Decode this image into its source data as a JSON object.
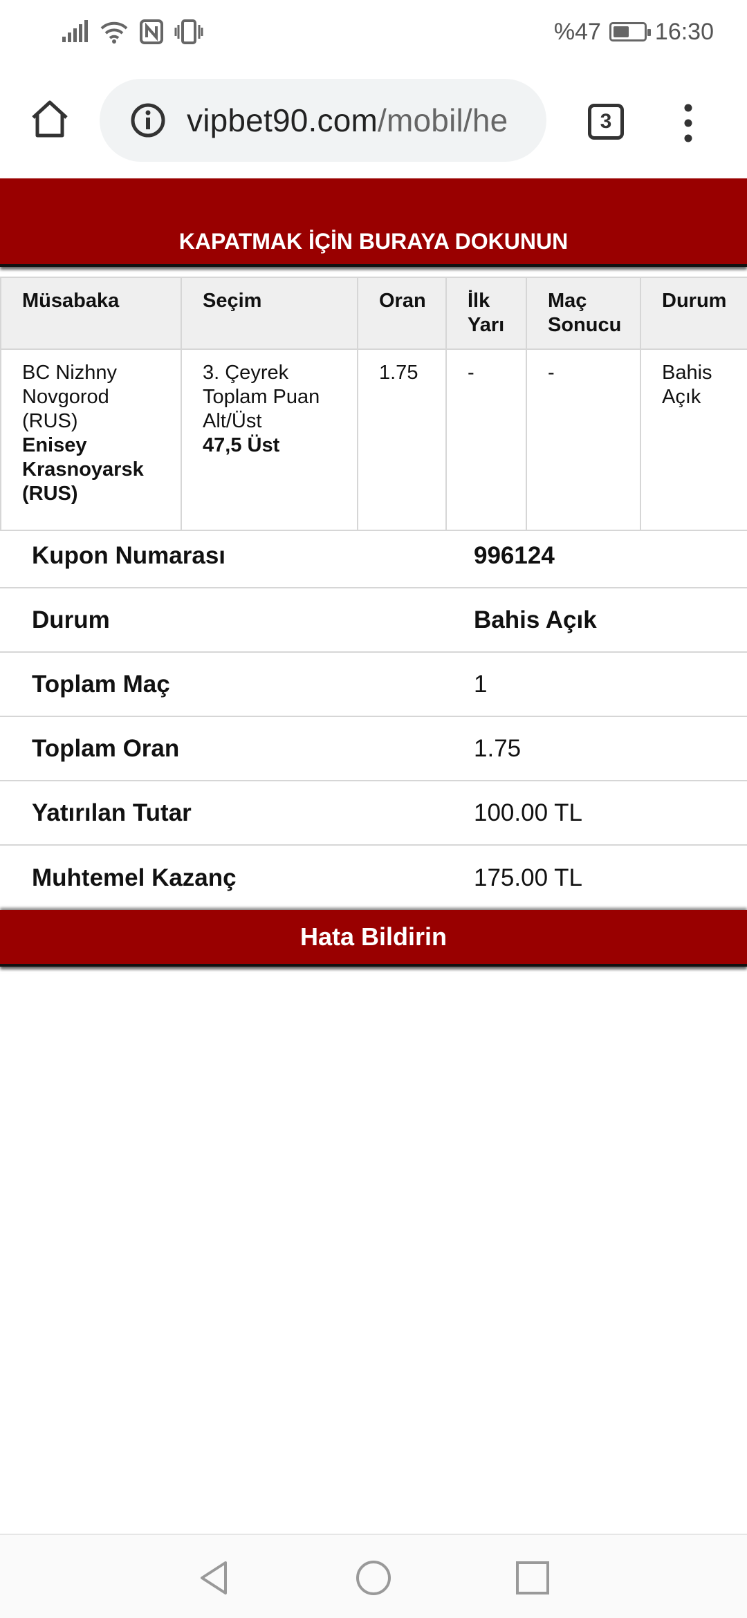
{
  "status_bar": {
    "battery_text": "%47",
    "time": "16:30",
    "battery_level_percent": 47,
    "icons": [
      "signal-icon",
      "wifi-icon",
      "nfc-icon",
      "vibrate-icon",
      "battery-icon"
    ]
  },
  "browser": {
    "url_domain": "vipbet90.com",
    "url_path": "/mobil/he",
    "tab_count": "3",
    "icons": [
      "home-icon",
      "info-icon",
      "tabs-icon",
      "more-vert-icon"
    ]
  },
  "banner": {
    "close_text": "KAPATMAK İÇİN BURAYA DOKUNUN",
    "color": "#990000"
  },
  "bet_table": {
    "headers": {
      "match": "Müsabaka",
      "selection": "Seçim",
      "odds": "Oran",
      "first_half_line1": "İlk",
      "first_half_line2": "Yarı",
      "result_line1": "Maç",
      "result_line2": "Sonucu",
      "status": "Durum"
    },
    "row": {
      "home_team_line1": "BC Nizhny",
      "home_team_line2": "Novgorod",
      "home_team_line3": "(RUS)",
      "away_team_line1": "Enisey",
      "away_team_line2": "Krasnoyarsk",
      "away_team_line3": "(RUS)",
      "selection_line1": "3. Çeyrek",
      "selection_line2": "Toplam Puan",
      "selection_line3": "Alt/Üst",
      "selection_pick": "47,5 Üst",
      "odds": "1.75",
      "first_half": "-",
      "result": "-",
      "status_line1": "Bahis",
      "status_line2": "Açık"
    }
  },
  "summary": [
    {
      "label": "Kupon Numarası",
      "value": "996124"
    },
    {
      "label": "Durum",
      "value": "Bahis Açık"
    },
    {
      "label": "Toplam Maç",
      "value": "1"
    },
    {
      "label": "Toplam Oran",
      "value": "1.75"
    },
    {
      "label": "Yatırılan Tutar",
      "value": "100.00 TL"
    },
    {
      "label": "Muhtemel Kazanç",
      "value": "175.00 TL"
    }
  ],
  "report_button": {
    "label": "Hata Bildirin"
  },
  "nav_bar": {
    "icons": [
      "back-icon",
      "home-circle-icon",
      "recents-icon"
    ]
  }
}
